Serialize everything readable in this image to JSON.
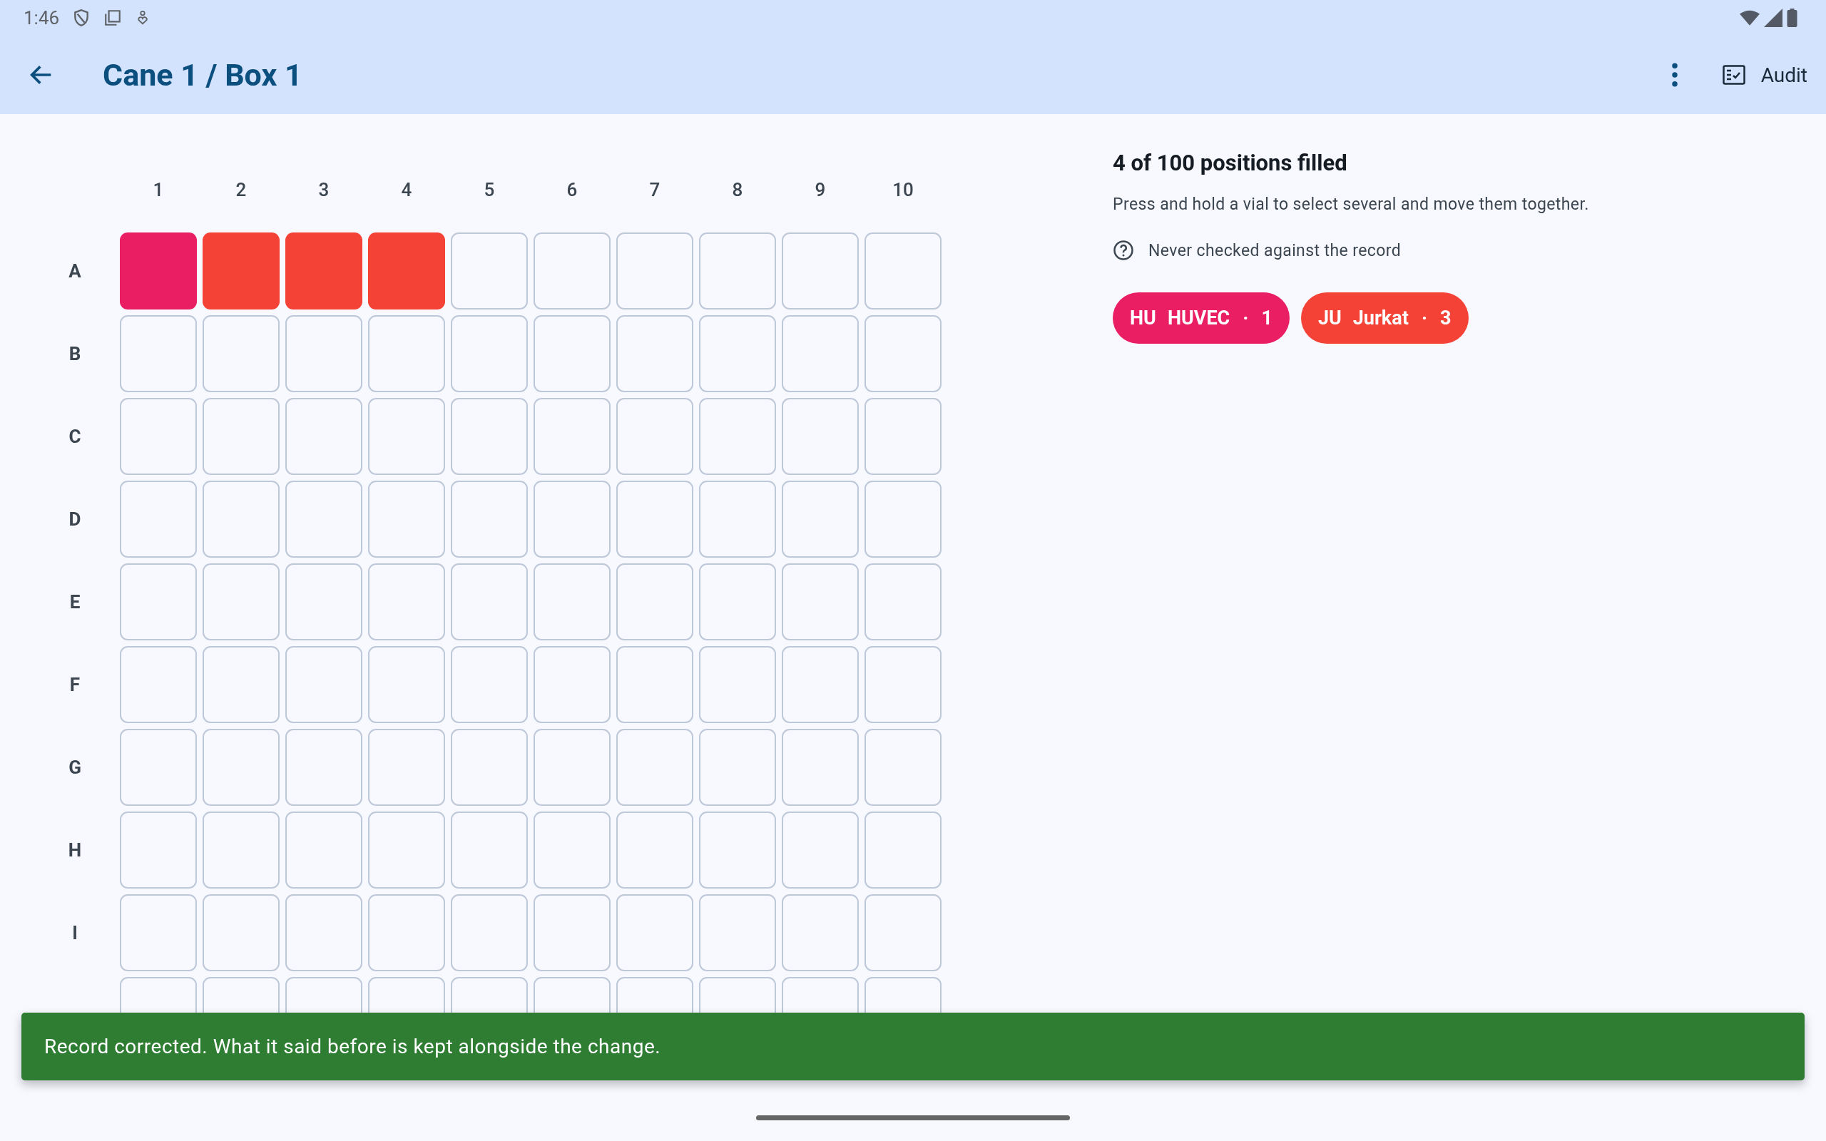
{
  "status_bar": {
    "time": "1:46"
  },
  "app_bar": {
    "title": "Cane 1 / Box 1",
    "action": "Audit"
  },
  "grid": {
    "columns": [
      "1",
      "2",
      "3",
      "4",
      "5",
      "6",
      "7",
      "8",
      "9",
      "10"
    ],
    "rows": [
      {
        "label": "A",
        "cells": [
          {
            "filled": true,
            "color": "#e91e63"
          },
          {
            "filled": true,
            "color": "#f44336"
          },
          {
            "filled": true,
            "color": "#f44336"
          },
          {
            "filled": true,
            "color": "#f44336"
          },
          {
            "filled": false
          },
          {
            "filled": false
          },
          {
            "filled": false
          },
          {
            "filled": false
          },
          {
            "filled": false
          },
          {
            "filled": false
          }
        ]
      },
      {
        "label": "B",
        "cells": [
          {
            "filled": false
          },
          {
            "filled": false
          },
          {
            "filled": false
          },
          {
            "filled": false
          },
          {
            "filled": false
          },
          {
            "filled": false
          },
          {
            "filled": false
          },
          {
            "filled": false
          },
          {
            "filled": false
          },
          {
            "filled": false
          }
        ]
      },
      {
        "label": "C",
        "cells": [
          {
            "filled": false
          },
          {
            "filled": false
          },
          {
            "filled": false
          },
          {
            "filled": false
          },
          {
            "filled": false
          },
          {
            "filled": false
          },
          {
            "filled": false
          },
          {
            "filled": false
          },
          {
            "filled": false
          },
          {
            "filled": false
          }
        ]
      },
      {
        "label": "D",
        "cells": [
          {
            "filled": false
          },
          {
            "filled": false
          },
          {
            "filled": false
          },
          {
            "filled": false
          },
          {
            "filled": false
          },
          {
            "filled": false
          },
          {
            "filled": false
          },
          {
            "filled": false
          },
          {
            "filled": false
          },
          {
            "filled": false
          }
        ]
      },
      {
        "label": "E",
        "cells": [
          {
            "filled": false
          },
          {
            "filled": false
          },
          {
            "filled": false
          },
          {
            "filled": false
          },
          {
            "filled": false
          },
          {
            "filled": false
          },
          {
            "filled": false
          },
          {
            "filled": false
          },
          {
            "filled": false
          },
          {
            "filled": false
          }
        ]
      },
      {
        "label": "F",
        "cells": [
          {
            "filled": false
          },
          {
            "filled": false
          },
          {
            "filled": false
          },
          {
            "filled": false
          },
          {
            "filled": false
          },
          {
            "filled": false
          },
          {
            "filled": false
          },
          {
            "filled": false
          },
          {
            "filled": false
          },
          {
            "filled": false
          }
        ]
      },
      {
        "label": "G",
        "cells": [
          {
            "filled": false
          },
          {
            "filled": false
          },
          {
            "filled": false
          },
          {
            "filled": false
          },
          {
            "filled": false
          },
          {
            "filled": false
          },
          {
            "filled": false
          },
          {
            "filled": false
          },
          {
            "filled": false
          },
          {
            "filled": false
          }
        ]
      },
      {
        "label": "H",
        "cells": [
          {
            "filled": false
          },
          {
            "filled": false
          },
          {
            "filled": false
          },
          {
            "filled": false
          },
          {
            "filled": false
          },
          {
            "filled": false
          },
          {
            "filled": false
          },
          {
            "filled": false
          },
          {
            "filled": false
          },
          {
            "filled": false
          }
        ]
      },
      {
        "label": "I",
        "cells": [
          {
            "filled": false
          },
          {
            "filled": false
          },
          {
            "filled": false
          },
          {
            "filled": false
          },
          {
            "filled": false
          },
          {
            "filled": false
          },
          {
            "filled": false
          },
          {
            "filled": false
          },
          {
            "filled": false
          },
          {
            "filled": false
          }
        ]
      },
      {
        "cells": [
          {
            "filled": false
          },
          {
            "filled": false
          },
          {
            "filled": false
          },
          {
            "filled": false
          },
          {
            "filled": false
          },
          {
            "filled": false
          },
          {
            "filled": false
          },
          {
            "filled": false
          },
          {
            "filled": false
          },
          {
            "filled": false
          }
        ]
      }
    ]
  },
  "summary": {
    "title": "4 of 100 positions filled",
    "hint": "Press and hold a vial to select several and move them together.",
    "audit_status": "Never checked against the record"
  },
  "legend": [
    {
      "code": "HU",
      "name": "HUVEC",
      "separator": "·",
      "count": "1",
      "color": "#e91e63"
    },
    {
      "code": "JU",
      "name": "Jurkat",
      "separator": "·",
      "count": "3",
      "color": "#f44336"
    }
  ],
  "snackbar": {
    "message": "Record corrected. What it said before is kept alongside the change."
  }
}
